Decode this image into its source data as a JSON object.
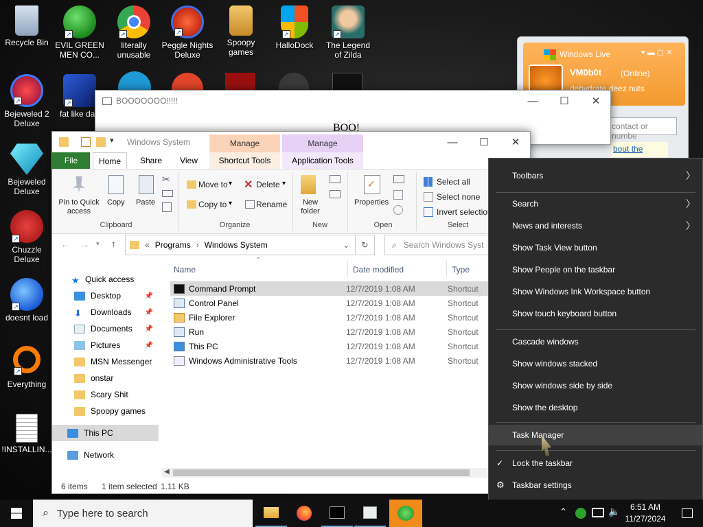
{
  "desktop_icons": [
    {
      "label": "Recycle Bin"
    },
    {
      "label": "EVIL GREEN MEN CO..."
    },
    {
      "label": "literally unusable"
    },
    {
      "label": "Peggle Nights Deluxe"
    },
    {
      "label": "Spoopy games"
    },
    {
      "label": "HalloDock"
    },
    {
      "label": "The Legend of Zilda"
    },
    {
      "label": "Bejeweled 2 Deluxe"
    },
    {
      "label": "fat like darl"
    },
    {
      "label": "Bejeweled Deluxe"
    },
    {
      "label": "Chuzzle Deluxe"
    },
    {
      "label": "doesnt load"
    },
    {
      "label": "Everything"
    },
    {
      "label": "!INSTALLIN..."
    }
  ],
  "boo_window": {
    "title": "BOOOOOOO!!!!!",
    "body": "BOO!"
  },
  "messenger": {
    "title": "Windows Live",
    "username": "VM0b0t",
    "status": "(Online)",
    "personal_message": "dehydrate deez nuts",
    "search_placeholder": "contact or numbe",
    "link_text": "bout the"
  },
  "explorer": {
    "title": "Windows System",
    "context_tab_manage1": "Manage",
    "context_tab_manage2": "Manage",
    "tabs": [
      "File",
      "Home",
      "Share",
      "View",
      "Shortcut Tools",
      "Application Tools"
    ],
    "ribbon": {
      "pin": "Pin to Quick access",
      "copy": "Copy",
      "paste": "Paste",
      "move_to": "Move to",
      "delete": "Delete",
      "copy_to": "Copy to",
      "rename": "Rename",
      "new_folder": "New folder",
      "properties": "Properties",
      "select_all": "Select all",
      "select_none": "Select none",
      "invert_selection": "Invert selection",
      "groups": [
        "Clipboard",
        "Organize",
        "New",
        "Open",
        "Select"
      ]
    },
    "breadcrumb": [
      "Programs",
      "Windows System"
    ],
    "search_placeholder": "Search Windows Syst",
    "nav": [
      {
        "label": "Quick access"
      },
      {
        "label": "Desktop"
      },
      {
        "label": "Downloads"
      },
      {
        "label": "Documents"
      },
      {
        "label": "Pictures"
      },
      {
        "label": "MSN Messenger"
      },
      {
        "label": "onstar"
      },
      {
        "label": "Scary Shit"
      },
      {
        "label": "Spoopy games"
      },
      {
        "label": "This PC"
      },
      {
        "label": "Network"
      }
    ],
    "columns": [
      "Name",
      "Date modified",
      "Type"
    ],
    "files": [
      {
        "name": "Command Prompt",
        "date": "12/7/2019 1:08 AM",
        "type": "Shortcut"
      },
      {
        "name": "Control Panel",
        "date": "12/7/2019 1:08 AM",
        "type": "Shortcut"
      },
      {
        "name": "File Explorer",
        "date": "12/7/2019 1:08 AM",
        "type": "Shortcut"
      },
      {
        "name": "Run",
        "date": "12/7/2019 1:08 AM",
        "type": "Shortcut"
      },
      {
        "name": "This PC",
        "date": "12/7/2019 1:08 AM",
        "type": "Shortcut"
      },
      {
        "name": "Windows Administrative Tools",
        "date": "12/7/2019 1:08 AM",
        "type": "Shortcut"
      }
    ],
    "status": {
      "items": "6 items",
      "selected": "1 item selected",
      "size": "1.11 KB"
    }
  },
  "context_menu": {
    "items": [
      "Toolbars",
      "Search",
      "News and interests",
      "Show Task View button",
      "Show People on the taskbar",
      "Show Windows Ink Workspace button",
      "Show touch keyboard button",
      "Cascade windows",
      "Show windows stacked",
      "Show windows side by side",
      "Show the desktop",
      "Task Manager",
      "Lock the taskbar",
      "Taskbar settings"
    ],
    "check_mark": "✓"
  },
  "taskbar": {
    "search_placeholder": "Type here to search",
    "time": "6:51 AM",
    "date": "11/27/2024"
  },
  "colors": {
    "file_tab": "#2e7d32",
    "manage1": "#fbd3b8",
    "manage2": "#e6d0f4",
    "menu_bg": "#2b2b2b",
    "messenger_orange": "#f5a03c"
  }
}
